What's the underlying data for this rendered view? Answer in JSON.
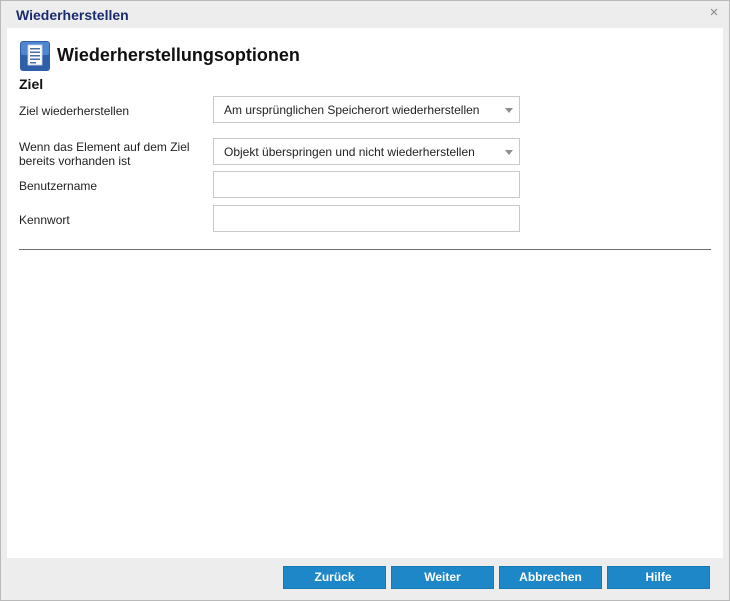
{
  "dialog": {
    "title": "Wiederherstellen",
    "close_glyph": "×",
    "icon": "document-list-icon",
    "accent_color": "#1e87c8",
    "title_color": "#1a2c6e"
  },
  "header": {
    "title": "Wiederherstellungsoptionen"
  },
  "section": {
    "title": "Ziel"
  },
  "form": {
    "restore_target": {
      "label": "Ziel wiederherstellen",
      "value": "Am ursprünglichen Speicherort wiederherstellen"
    },
    "if_exists": {
      "label_line1": "Wenn das Element auf dem Ziel",
      "label_line2": "bereits vorhanden ist",
      "value": "Objekt überspringen und nicht wiederherstellen"
    },
    "username": {
      "label": "Benutzername",
      "value": ""
    },
    "password": {
      "label": "Kennwort",
      "value": ""
    }
  },
  "buttons": {
    "back": "Zurück",
    "next": "Weiter",
    "cancel": "Abbrechen",
    "help": "Hilfe"
  }
}
